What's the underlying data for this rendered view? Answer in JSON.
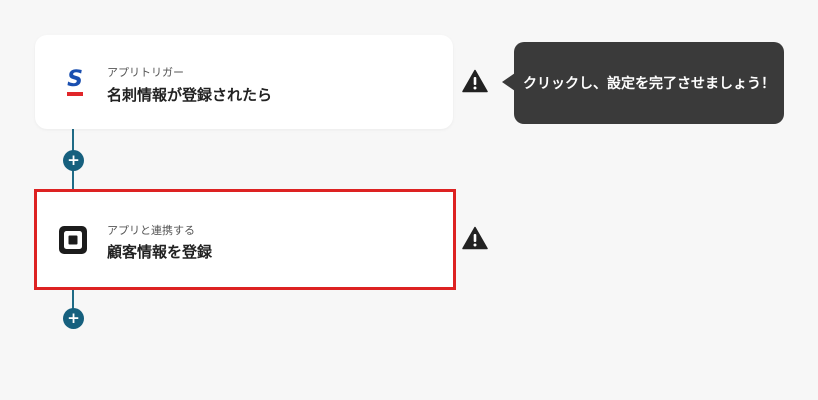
{
  "flow": {
    "trigger": {
      "subtitle": "アプリトリガー",
      "title": "名刺情報が登録されたら",
      "icon": "sansan-logo",
      "icon_text": "S",
      "status_icon": "warning-icon"
    },
    "action": {
      "subtitle": "アプリと連携する",
      "title": "顧客情報を登録",
      "icon": "square-logo",
      "status_icon": "warning-icon"
    },
    "add_button_label": "+"
  },
  "tooltip": {
    "text": "クリックし、設定を完了させましょう！"
  },
  "colors": {
    "background": "#f7f7f7",
    "connector": "#1f6b86",
    "add_button": "#16607e",
    "highlight_border": "#dd2222",
    "tooltip_bg": "#3a3a3a",
    "sansan_blue": "#1a4fb0",
    "sansan_red": "#e0262a"
  }
}
